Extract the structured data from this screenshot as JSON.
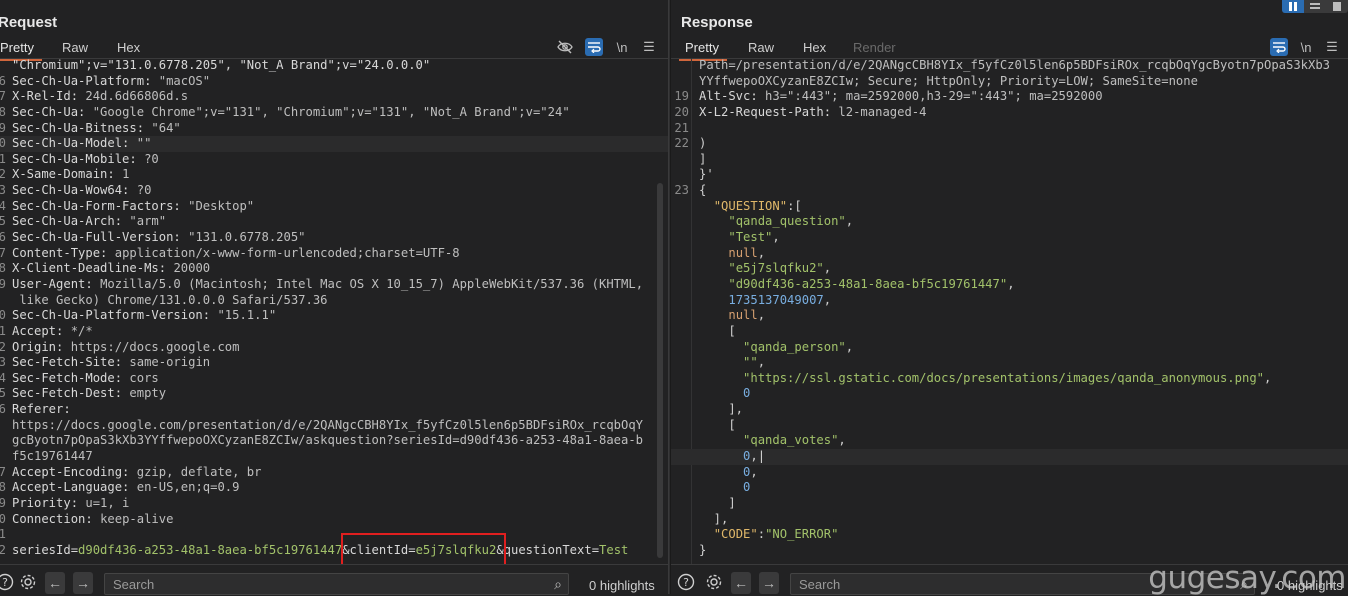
{
  "request": {
    "title": "Request",
    "tabs": [
      {
        "label": "Pretty",
        "active": true
      },
      {
        "label": "Raw"
      },
      {
        "label": "Hex"
      }
    ],
    "toolbar": {
      "hide_icon": "eye-slash-icon",
      "wrap_icon": "wrap-lines-icon",
      "newline_label": "\\n",
      "menu_icon": "hamburger-menu-icon"
    },
    "lines": [
      {
        "n": "",
        "k": "\"Chromium\";v=\"131.0.6778.205\", \"Not_A Brand\";v=\"24.0.0.0\"",
        "v": ""
      },
      {
        "n": "6",
        "k": "Sec-Ch-Ua-Platform: ",
        "v": "\"macOS\""
      },
      {
        "n": "7",
        "k": "X-Rel-Id: ",
        "v": "24d.6d66806d.s"
      },
      {
        "n": "8",
        "k": "Sec-Ch-Ua: ",
        "v": "\"Google Chrome\";v=\"131\", \"Chromium\";v=\"131\", \"Not_A Brand\";v=\"24\""
      },
      {
        "n": "9",
        "k": "Sec-Ch-Ua-Bitness: ",
        "v": "\"64\""
      },
      {
        "n": "0",
        "k": "Sec-Ch-Ua-Model: ",
        "v": "\"\"",
        "hl": true
      },
      {
        "n": "1",
        "k": "Sec-Ch-Ua-Mobile: ",
        "v": "?0"
      },
      {
        "n": "2",
        "k": "X-Same-Domain: ",
        "v": "1"
      },
      {
        "n": "3",
        "k": "Sec-Ch-Ua-Wow64: ",
        "v": "?0"
      },
      {
        "n": "4",
        "k": "Sec-Ch-Ua-Form-Factors: ",
        "v": "\"Desktop\""
      },
      {
        "n": "5",
        "k": "Sec-Ch-Ua-Arch: ",
        "v": "\"arm\""
      },
      {
        "n": "6",
        "k": "Sec-Ch-Ua-Full-Version: ",
        "v": "\"131.0.6778.205\""
      },
      {
        "n": "7",
        "k": "Content-Type: ",
        "v": "application/x-www-form-urlencoded;charset=UTF-8"
      },
      {
        "n": "8",
        "k": "X-Client-Deadline-Ms: ",
        "v": "20000"
      },
      {
        "n": "9",
        "k": "User-Agent: ",
        "v": "Mozilla/5.0 (Macintosh; Intel Mac OS X 10_15_7) AppleWebKit/537.36 (KHTML,"
      },
      {
        "n": "",
        "k": "",
        "v": " like Gecko) Chrome/131.0.0.0 Safari/537.36"
      },
      {
        "n": "0",
        "k": "Sec-Ch-Ua-Platform-Version: ",
        "v": "\"15.1.1\""
      },
      {
        "n": "1",
        "k": "Accept: ",
        "v": "*/*"
      },
      {
        "n": "2",
        "k": "Origin: ",
        "v": "https://docs.google.com"
      },
      {
        "n": "3",
        "k": "Sec-Fetch-Site: ",
        "v": "same-origin"
      },
      {
        "n": "4",
        "k": "Sec-Fetch-Mode: ",
        "v": "cors"
      },
      {
        "n": "5",
        "k": "Sec-Fetch-Dest: ",
        "v": "empty"
      },
      {
        "n": "6",
        "k": "Referer: ",
        "v": ""
      },
      {
        "n": "",
        "k": "",
        "v": "https://docs.google.com/presentation/d/e/2QANgcCBH8YIx_f5yfCz0l5len6p5BDFsiROx_rcqbOqY"
      },
      {
        "n": "",
        "k": "",
        "v": "gcByotn7pOpaS3kXb3YYffwepoOXCyzanE8ZCIw/askquestion?seriesId=d90df436-a253-48a1-8aea-b"
      },
      {
        "n": "",
        "k": "",
        "v": "f5c19761447"
      },
      {
        "n": "7",
        "k": "Accept-Encoding: ",
        "v": "gzip, deflate, br"
      },
      {
        "n": "8",
        "k": "Accept-Language: ",
        "v": "en-US,en;q=0.9"
      },
      {
        "n": "9",
        "k": "Priority: ",
        "v": "u=1, i"
      },
      {
        "n": "0",
        "k": "Connection: ",
        "v": "keep-alive"
      },
      {
        "n": "1",
        "k": "",
        "v": ""
      }
    ],
    "body": {
      "n": "2",
      "parts": [
        {
          "t": "seriesId",
          "c": "k"
        },
        {
          "t": "=",
          "c": "k"
        },
        {
          "t": "d90df436-a253-48a1-8aea-bf5c19761447",
          "c": "gr"
        },
        {
          "t": "&clientId",
          "c": "k"
        },
        {
          "t": "=",
          "c": "k"
        },
        {
          "t": "e5j7slqfku2",
          "c": "gr"
        },
        {
          "t": "&questionText",
          "c": "k"
        },
        {
          "t": "=",
          "c": "k"
        },
        {
          "t": "Test",
          "c": "gr"
        }
      ]
    },
    "footer": {
      "search_placeholder": "Search",
      "highlights": "0 highlights"
    }
  },
  "response": {
    "title": "Response",
    "tabs": [
      {
        "label": "Pretty",
        "active": true
      },
      {
        "label": "Raw"
      },
      {
        "label": "Hex"
      },
      {
        "label": "Render",
        "disabled": true
      }
    ],
    "toolbar": {
      "wrap_icon": "wrap-lines-icon",
      "newline_label": "\\n",
      "menu_icon": "hamburger-menu-icon"
    },
    "lines": [
      {
        "n": "",
        "segs": [
          {
            "t": "Path=/presentation/d/e/2QANgcCBH8YIx_f5yfCz0l5len6p5BDFsiROx_rcqbOqYgcByotn7pOpaS3kXb3",
            "c": "v"
          }
        ]
      },
      {
        "n": "",
        "segs": [
          {
            "t": "YYffwepoOXCyzanE8ZCIw; Secure; HttpOnly; Priority=LOW; SameSite=none",
            "c": "v"
          }
        ]
      },
      {
        "n": "19",
        "segs": [
          {
            "t": "Alt-Svc: ",
            "c": "k"
          },
          {
            "t": "h3=\":443\"; ma=2592000,h3-29=\":443\"; ma=2592000",
            "c": "v"
          }
        ]
      },
      {
        "n": "20",
        "segs": [
          {
            "t": "X-L2-Request-Path: ",
            "c": "k"
          },
          {
            "t": "l2-managed-4",
            "c": "v"
          }
        ]
      },
      {
        "n": "21",
        "segs": []
      },
      {
        "n": "22",
        "segs": [
          {
            "t": ")",
            "c": "pun"
          }
        ]
      },
      {
        "n": "",
        "segs": [
          {
            "t": "]",
            "c": "pun"
          }
        ]
      },
      {
        "n": "",
        "segs": [
          {
            "t": "}'",
            "c": "pun"
          }
        ]
      },
      {
        "n": "23",
        "segs": [
          {
            "t": "{",
            "c": "pun"
          }
        ]
      },
      {
        "n": "",
        "segs": [
          {
            "t": "  ",
            "c": "pun"
          },
          {
            "t": "\"QUESTION\"",
            "c": "key"
          },
          {
            "t": ":[",
            "c": "pun"
          }
        ]
      },
      {
        "n": "",
        "segs": [
          {
            "t": "    ",
            "c": "pun"
          },
          {
            "t": "\"qanda_question\"",
            "c": "gr"
          },
          {
            "t": ",",
            "c": "pun"
          }
        ]
      },
      {
        "n": "",
        "segs": [
          {
            "t": "    ",
            "c": "pun"
          },
          {
            "t": "\"Test\"",
            "c": "gr"
          },
          {
            "t": ",",
            "c": "pun"
          }
        ]
      },
      {
        "n": "",
        "segs": [
          {
            "t": "    ",
            "c": "pun"
          },
          {
            "t": "null",
            "c": "nul"
          },
          {
            "t": ",",
            "c": "pun"
          }
        ]
      },
      {
        "n": "",
        "segs": [
          {
            "t": "    ",
            "c": "pun"
          },
          {
            "t": "\"e5j7slqfku2\"",
            "c": "gr"
          },
          {
            "t": ",",
            "c": "pun"
          }
        ]
      },
      {
        "n": "",
        "segs": [
          {
            "t": "    ",
            "c": "pun"
          },
          {
            "t": "\"d90df436-a253-48a1-8aea-bf5c19761447\"",
            "c": "gr"
          },
          {
            "t": ",",
            "c": "pun"
          }
        ]
      },
      {
        "n": "",
        "segs": [
          {
            "t": "    ",
            "c": "pun"
          },
          {
            "t": "1735137049007",
            "c": "num"
          },
          {
            "t": ",",
            "c": "pun"
          }
        ]
      },
      {
        "n": "",
        "segs": [
          {
            "t": "    ",
            "c": "pun"
          },
          {
            "t": "null",
            "c": "nul"
          },
          {
            "t": ",",
            "c": "pun"
          }
        ]
      },
      {
        "n": "",
        "segs": [
          {
            "t": "    [",
            "c": "pun"
          }
        ]
      },
      {
        "n": "",
        "segs": [
          {
            "t": "      ",
            "c": "pun"
          },
          {
            "t": "\"qanda_person\"",
            "c": "gr"
          },
          {
            "t": ",",
            "c": "pun"
          }
        ]
      },
      {
        "n": "",
        "segs": [
          {
            "t": "      ",
            "c": "pun"
          },
          {
            "t": "\"\"",
            "c": "gr"
          },
          {
            "t": ",",
            "c": "pun"
          }
        ]
      },
      {
        "n": "",
        "segs": [
          {
            "t": "      ",
            "c": "pun"
          },
          {
            "t": "\"https://ssl.gstatic.com/docs/presentations/images/qanda_anonymous.png\"",
            "c": "gr"
          },
          {
            "t": ",",
            "c": "pun"
          }
        ]
      },
      {
        "n": "",
        "segs": [
          {
            "t": "      ",
            "c": "pun"
          },
          {
            "t": "0",
            "c": "num"
          }
        ]
      },
      {
        "n": "",
        "segs": [
          {
            "t": "    ],",
            "c": "pun"
          }
        ]
      },
      {
        "n": "",
        "segs": [
          {
            "t": "    [",
            "c": "pun"
          }
        ]
      },
      {
        "n": "",
        "segs": [
          {
            "t": "      ",
            "c": "pun"
          },
          {
            "t": "\"qanda_votes\"",
            "c": "gr"
          },
          {
            "t": ",",
            "c": "pun"
          }
        ]
      },
      {
        "n": "",
        "hl": true,
        "segs": [
          {
            "t": "      ",
            "c": "pun"
          },
          {
            "t": "0",
            "c": "num"
          },
          {
            "t": ",",
            "c": "pun"
          },
          {
            "t": "|",
            "c": "k"
          }
        ]
      },
      {
        "n": "",
        "segs": [
          {
            "t": "      ",
            "c": "pun"
          },
          {
            "t": "0",
            "c": "num"
          },
          {
            "t": ",",
            "c": "pun"
          }
        ]
      },
      {
        "n": "",
        "segs": [
          {
            "t": "      ",
            "c": "pun"
          },
          {
            "t": "0",
            "c": "num"
          }
        ]
      },
      {
        "n": "",
        "segs": [
          {
            "t": "    ]",
            "c": "pun"
          }
        ]
      },
      {
        "n": "",
        "segs": [
          {
            "t": "  ],",
            "c": "pun"
          }
        ]
      },
      {
        "n": "",
        "segs": [
          {
            "t": "  ",
            "c": "pun"
          },
          {
            "t": "\"CODE\"",
            "c": "key"
          },
          {
            "t": ":",
            "c": "pun"
          },
          {
            "t": "\"NO_ERROR\"",
            "c": "gr"
          }
        ]
      },
      {
        "n": "",
        "segs": [
          {
            "t": "}",
            "c": "pun"
          }
        ]
      }
    ],
    "footer": {
      "search_placeholder": "Search",
      "highlights": "0 highlights"
    }
  },
  "layout_switch": {
    "options": [
      "side-by-side",
      "stacked",
      "single"
    ],
    "active": "side-by-side"
  },
  "watermark": "gugesay.com"
}
